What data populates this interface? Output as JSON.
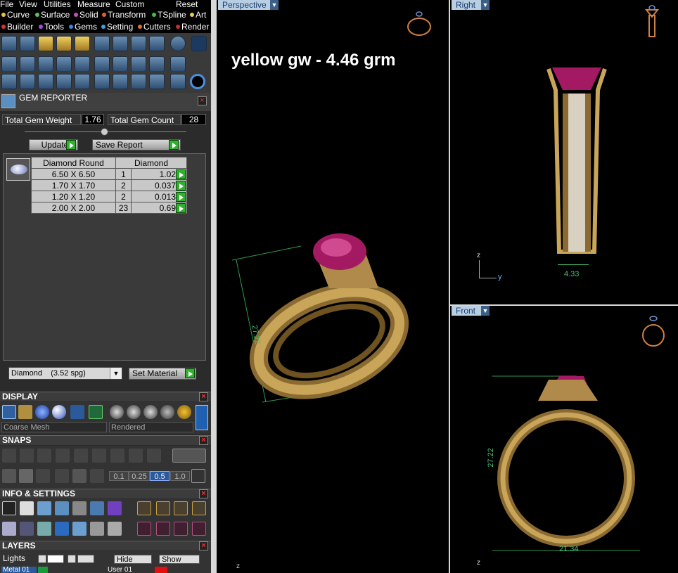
{
  "menu": [
    "File",
    "View",
    "Utilities",
    "Measure",
    "Custom",
    "Reset"
  ],
  "plugins_row1": [
    "Curve",
    "Surface",
    "Solid",
    "Transform",
    "TSpline",
    "Art"
  ],
  "plugins_row2": [
    "Builder",
    "Tools",
    "Gems",
    "Setting",
    "Cutters",
    "Render"
  ],
  "gem_reporter": {
    "title": "GEM REPORTER",
    "total_weight_label": "Total Gem Weight",
    "total_weight_value": "1.76",
    "total_count_label": "Total Gem Count",
    "total_count_value": "28",
    "update_label": "Update",
    "save_label": "Save Report",
    "table_headers": [
      "Diamond Round",
      "Diamond"
    ],
    "rows": [
      {
        "size": "6.50 X 6.50",
        "qty": "1",
        "wt": "1.02tw"
      },
      {
        "size": "1.70 X 1.70",
        "qty": "2",
        "wt": "0.037tw"
      },
      {
        "size": "1.20 X 1.20",
        "qty": "2",
        "wt": "0.013tw"
      },
      {
        "size": "2.00 X 2.00",
        "qty": "23",
        "wt": "0.69tw"
      }
    ],
    "material_value": "Diamond    (3.52 spg)",
    "set_material_label": "Set Material"
  },
  "display": {
    "title": "DISPLAY",
    "mesh": "Coarse Mesh",
    "render": "Rendered"
  },
  "snaps": {
    "title": "SNAPS",
    "values": [
      "0.1",
      "0.25",
      "0.5",
      "1.0"
    ]
  },
  "info": {
    "title": "INFO & SETTINGS"
  },
  "layers": {
    "title": "LAYERS",
    "lights": "Lights",
    "hide": "Hide",
    "show": "Show",
    "metal": "Metal 01",
    "user": "User 01"
  },
  "viewports": {
    "perspective": "Perspective",
    "right": "Right",
    "front": "Front",
    "overlay_text": "yellow gw - 4.46 grm",
    "dim_persp": "27.22",
    "dim_right": "4.33",
    "dim_front_v": "27.22",
    "dim_front_h": "21.34",
    "axis_z": "z",
    "axis_y": "y"
  },
  "colors": {
    "gold": "#b08a4a",
    "gem": "#b0206a",
    "accent": "#2fb02f"
  }
}
